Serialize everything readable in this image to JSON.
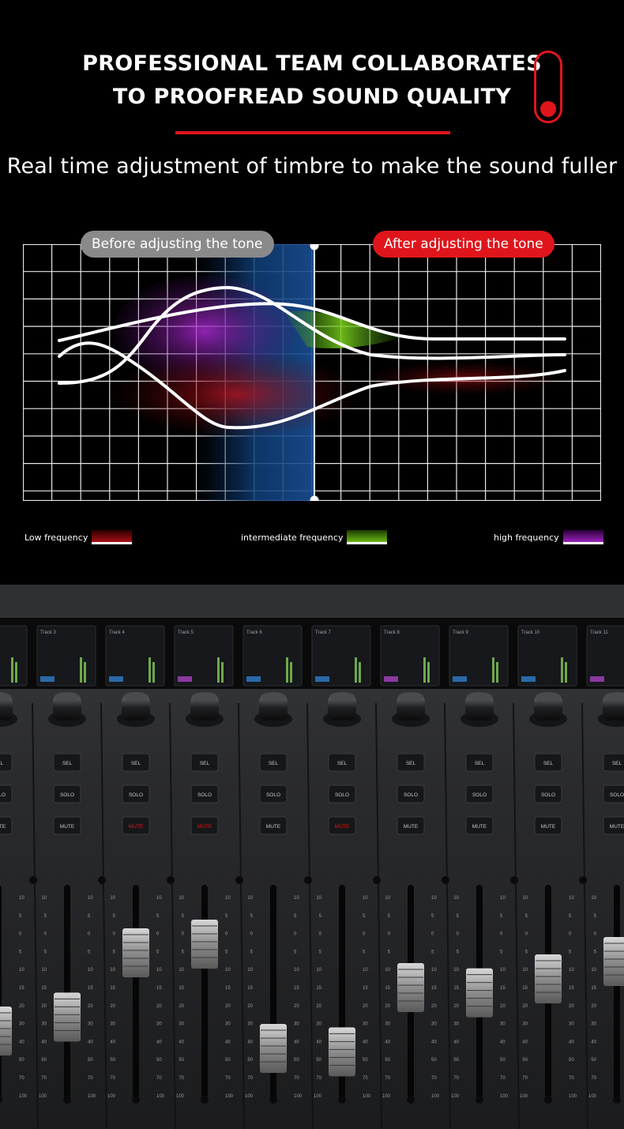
{
  "header": {
    "title_line1": "PROFESSIONAL TEAM COLLABORATES",
    "title_line2": "TO PROOFREAD SOUND QUALITY",
    "subtitle": "Real time adjustment of timbre to make the sound fuller",
    "icon": "toggle-switch-icon",
    "accent_color": "#e0151c"
  },
  "comparison": {
    "before_label": "Before adjusting the tone",
    "after_label": "After adjusting the tone"
  },
  "legend": [
    {
      "label": "Low frequency",
      "color": "#c0101a"
    },
    {
      "label": "intermediate frequency",
      "color": "#6fbf16"
    },
    {
      "label": "high frequency",
      "color": "#a522c8"
    }
  ],
  "mixer": {
    "track_names": [
      "Track 3",
      "Track 4",
      "Track 5",
      "Track 6",
      "Track 7",
      "Track 8",
      "Track 9",
      "Track 10",
      "Track 11"
    ],
    "channel_buttons": [
      "SEL",
      "SOLO",
      "MUTE"
    ],
    "fader_scale": [
      "10",
      "5",
      "0",
      "5",
      "10",
      "15",
      "20",
      "30",
      "40",
      "50",
      "70",
      "100"
    ],
    "fader_levels": [
      0.3,
      0.38,
      0.75,
      0.8,
      0.2,
      0.18,
      0.55,
      0.52,
      0.6,
      0.7
    ]
  }
}
